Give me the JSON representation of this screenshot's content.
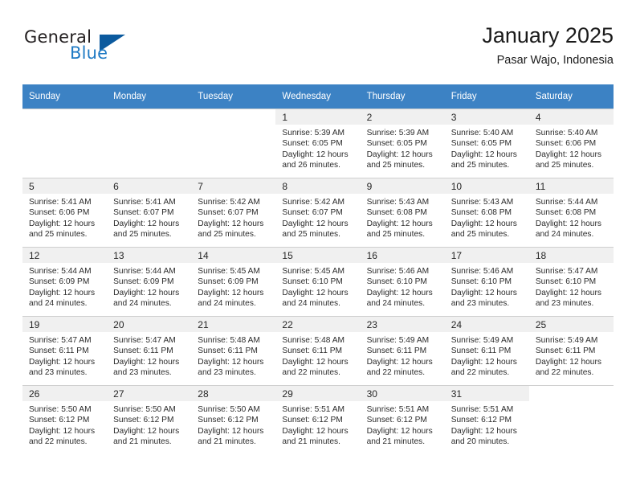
{
  "brand": {
    "name_part1": "General",
    "name_part2": "Blue",
    "triangle_icon": "triangle-icon"
  },
  "header": {
    "title": "January 2025",
    "subtitle": "Pasar Wajo, Indonesia"
  },
  "colors": {
    "header_blue": "#3c82c4",
    "brand_blue": "#1f7ac4",
    "triangle_blue": "#0b5a9e",
    "cell_shade": "#f0f0f0",
    "grid_line": "#cfcfcf"
  },
  "weekdays": [
    "Sunday",
    "Monday",
    "Tuesday",
    "Wednesday",
    "Thursday",
    "Friday",
    "Saturday"
  ],
  "labels": {
    "sunrise": "Sunrise:",
    "sunset": "Sunset:",
    "daylight": "Daylight:"
  },
  "weeks": [
    [
      {
        "day": "",
        "sunrise": "",
        "sunset": "",
        "daylight_line1": "",
        "daylight_line2": ""
      },
      {
        "day": "",
        "sunrise": "",
        "sunset": "",
        "daylight_line1": "",
        "daylight_line2": ""
      },
      {
        "day": "",
        "sunrise": "",
        "sunset": "",
        "daylight_line1": "",
        "daylight_line2": ""
      },
      {
        "day": "1",
        "sunrise": "Sunrise: 5:39 AM",
        "sunset": "Sunset: 6:05 PM",
        "daylight_line1": "Daylight: 12 hours",
        "daylight_line2": "and 26 minutes."
      },
      {
        "day": "2",
        "sunrise": "Sunrise: 5:39 AM",
        "sunset": "Sunset: 6:05 PM",
        "daylight_line1": "Daylight: 12 hours",
        "daylight_line2": "and 25 minutes."
      },
      {
        "day": "3",
        "sunrise": "Sunrise: 5:40 AM",
        "sunset": "Sunset: 6:05 PM",
        "daylight_line1": "Daylight: 12 hours",
        "daylight_line2": "and 25 minutes."
      },
      {
        "day": "4",
        "sunrise": "Sunrise: 5:40 AM",
        "sunset": "Sunset: 6:06 PM",
        "daylight_line1": "Daylight: 12 hours",
        "daylight_line2": "and 25 minutes."
      }
    ],
    [
      {
        "day": "5",
        "sunrise": "Sunrise: 5:41 AM",
        "sunset": "Sunset: 6:06 PM",
        "daylight_line1": "Daylight: 12 hours",
        "daylight_line2": "and 25 minutes."
      },
      {
        "day": "6",
        "sunrise": "Sunrise: 5:41 AM",
        "sunset": "Sunset: 6:07 PM",
        "daylight_line1": "Daylight: 12 hours",
        "daylight_line2": "and 25 minutes."
      },
      {
        "day": "7",
        "sunrise": "Sunrise: 5:42 AM",
        "sunset": "Sunset: 6:07 PM",
        "daylight_line1": "Daylight: 12 hours",
        "daylight_line2": "and 25 minutes."
      },
      {
        "day": "8",
        "sunrise": "Sunrise: 5:42 AM",
        "sunset": "Sunset: 6:07 PM",
        "daylight_line1": "Daylight: 12 hours",
        "daylight_line2": "and 25 minutes."
      },
      {
        "day": "9",
        "sunrise": "Sunrise: 5:43 AM",
        "sunset": "Sunset: 6:08 PM",
        "daylight_line1": "Daylight: 12 hours",
        "daylight_line2": "and 25 minutes."
      },
      {
        "day": "10",
        "sunrise": "Sunrise: 5:43 AM",
        "sunset": "Sunset: 6:08 PM",
        "daylight_line1": "Daylight: 12 hours",
        "daylight_line2": "and 25 minutes."
      },
      {
        "day": "11",
        "sunrise": "Sunrise: 5:44 AM",
        "sunset": "Sunset: 6:08 PM",
        "daylight_line1": "Daylight: 12 hours",
        "daylight_line2": "and 24 minutes."
      }
    ],
    [
      {
        "day": "12",
        "sunrise": "Sunrise: 5:44 AM",
        "sunset": "Sunset: 6:09 PM",
        "daylight_line1": "Daylight: 12 hours",
        "daylight_line2": "and 24 minutes."
      },
      {
        "day": "13",
        "sunrise": "Sunrise: 5:44 AM",
        "sunset": "Sunset: 6:09 PM",
        "daylight_line1": "Daylight: 12 hours",
        "daylight_line2": "and 24 minutes."
      },
      {
        "day": "14",
        "sunrise": "Sunrise: 5:45 AM",
        "sunset": "Sunset: 6:09 PM",
        "daylight_line1": "Daylight: 12 hours",
        "daylight_line2": "and 24 minutes."
      },
      {
        "day": "15",
        "sunrise": "Sunrise: 5:45 AM",
        "sunset": "Sunset: 6:10 PM",
        "daylight_line1": "Daylight: 12 hours",
        "daylight_line2": "and 24 minutes."
      },
      {
        "day": "16",
        "sunrise": "Sunrise: 5:46 AM",
        "sunset": "Sunset: 6:10 PM",
        "daylight_line1": "Daylight: 12 hours",
        "daylight_line2": "and 24 minutes."
      },
      {
        "day": "17",
        "sunrise": "Sunrise: 5:46 AM",
        "sunset": "Sunset: 6:10 PM",
        "daylight_line1": "Daylight: 12 hours",
        "daylight_line2": "and 23 minutes."
      },
      {
        "day": "18",
        "sunrise": "Sunrise: 5:47 AM",
        "sunset": "Sunset: 6:10 PM",
        "daylight_line1": "Daylight: 12 hours",
        "daylight_line2": "and 23 minutes."
      }
    ],
    [
      {
        "day": "19",
        "sunrise": "Sunrise: 5:47 AM",
        "sunset": "Sunset: 6:11 PM",
        "daylight_line1": "Daylight: 12 hours",
        "daylight_line2": "and 23 minutes."
      },
      {
        "day": "20",
        "sunrise": "Sunrise: 5:47 AM",
        "sunset": "Sunset: 6:11 PM",
        "daylight_line1": "Daylight: 12 hours",
        "daylight_line2": "and 23 minutes."
      },
      {
        "day": "21",
        "sunrise": "Sunrise: 5:48 AM",
        "sunset": "Sunset: 6:11 PM",
        "daylight_line1": "Daylight: 12 hours",
        "daylight_line2": "and 23 minutes."
      },
      {
        "day": "22",
        "sunrise": "Sunrise: 5:48 AM",
        "sunset": "Sunset: 6:11 PM",
        "daylight_line1": "Daylight: 12 hours",
        "daylight_line2": "and 22 minutes."
      },
      {
        "day": "23",
        "sunrise": "Sunrise: 5:49 AM",
        "sunset": "Sunset: 6:11 PM",
        "daylight_line1": "Daylight: 12 hours",
        "daylight_line2": "and 22 minutes."
      },
      {
        "day": "24",
        "sunrise": "Sunrise: 5:49 AM",
        "sunset": "Sunset: 6:11 PM",
        "daylight_line1": "Daylight: 12 hours",
        "daylight_line2": "and 22 minutes."
      },
      {
        "day": "25",
        "sunrise": "Sunrise: 5:49 AM",
        "sunset": "Sunset: 6:11 PM",
        "daylight_line1": "Daylight: 12 hours",
        "daylight_line2": "and 22 minutes."
      }
    ],
    [
      {
        "day": "26",
        "sunrise": "Sunrise: 5:50 AM",
        "sunset": "Sunset: 6:12 PM",
        "daylight_line1": "Daylight: 12 hours",
        "daylight_line2": "and 22 minutes."
      },
      {
        "day": "27",
        "sunrise": "Sunrise: 5:50 AM",
        "sunset": "Sunset: 6:12 PM",
        "daylight_line1": "Daylight: 12 hours",
        "daylight_line2": "and 21 minutes."
      },
      {
        "day": "28",
        "sunrise": "Sunrise: 5:50 AM",
        "sunset": "Sunset: 6:12 PM",
        "daylight_line1": "Daylight: 12 hours",
        "daylight_line2": "and 21 minutes."
      },
      {
        "day": "29",
        "sunrise": "Sunrise: 5:51 AM",
        "sunset": "Sunset: 6:12 PM",
        "daylight_line1": "Daylight: 12 hours",
        "daylight_line2": "and 21 minutes."
      },
      {
        "day": "30",
        "sunrise": "Sunrise: 5:51 AM",
        "sunset": "Sunset: 6:12 PM",
        "daylight_line1": "Daylight: 12 hours",
        "daylight_line2": "and 21 minutes."
      },
      {
        "day": "31",
        "sunrise": "Sunrise: 5:51 AM",
        "sunset": "Sunset: 6:12 PM",
        "daylight_line1": "Daylight: 12 hours",
        "daylight_line2": "and 20 minutes."
      },
      {
        "day": "",
        "sunrise": "",
        "sunset": "",
        "daylight_line1": "",
        "daylight_line2": ""
      }
    ]
  ]
}
